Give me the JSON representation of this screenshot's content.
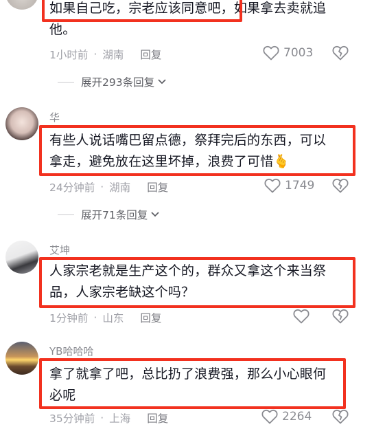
{
  "comments": [
    {
      "username": "",
      "text_line1_highlighted": "如果自己吃，宗老应该同意吧，",
      "text_line1_rest": "如果拿去卖就追",
      "text_line2": "他。",
      "time": "1小时前",
      "location": "湖南",
      "reply_label": "回复",
      "likes": "7003",
      "expand_label": "展开293条回复"
    },
    {
      "username": "华",
      "text_line1": "有些人说话嘴巴留点德，祭拜完后的东西，可以",
      "text_line2": "拿走，避免放在这里坏掉，浪费了可惜",
      "emoji": "🫰",
      "time": "24分钟前",
      "location": "湖南",
      "reply_label": "回复",
      "likes": "1749",
      "expand_label": "展开71条回复"
    },
    {
      "username": "艾坤",
      "text_line1": "人家宗老就是生产这个的，群众又拿这个来当祭",
      "text_line2": "品，人家宗老缺这个吗？",
      "time": "1分钟前",
      "location": "山东",
      "reply_label": "回复",
      "likes": ""
    },
    {
      "username": "YB哈哈哈",
      "text_line1": "拿了就拿了吧，总比扔了浪费强，那么小心眼何",
      "text_line2": "必呢",
      "time": "35分钟前",
      "location": "上海",
      "reply_label": "回复",
      "likes": "2264"
    }
  ],
  "colors": {
    "highlight_border": "#f2311f",
    "meta_text": "#a0a1a8",
    "body_text": "#161823"
  },
  "icons": [
    "heart-outline-icon",
    "broken-heart-icon",
    "chevron-down-icon"
  ]
}
